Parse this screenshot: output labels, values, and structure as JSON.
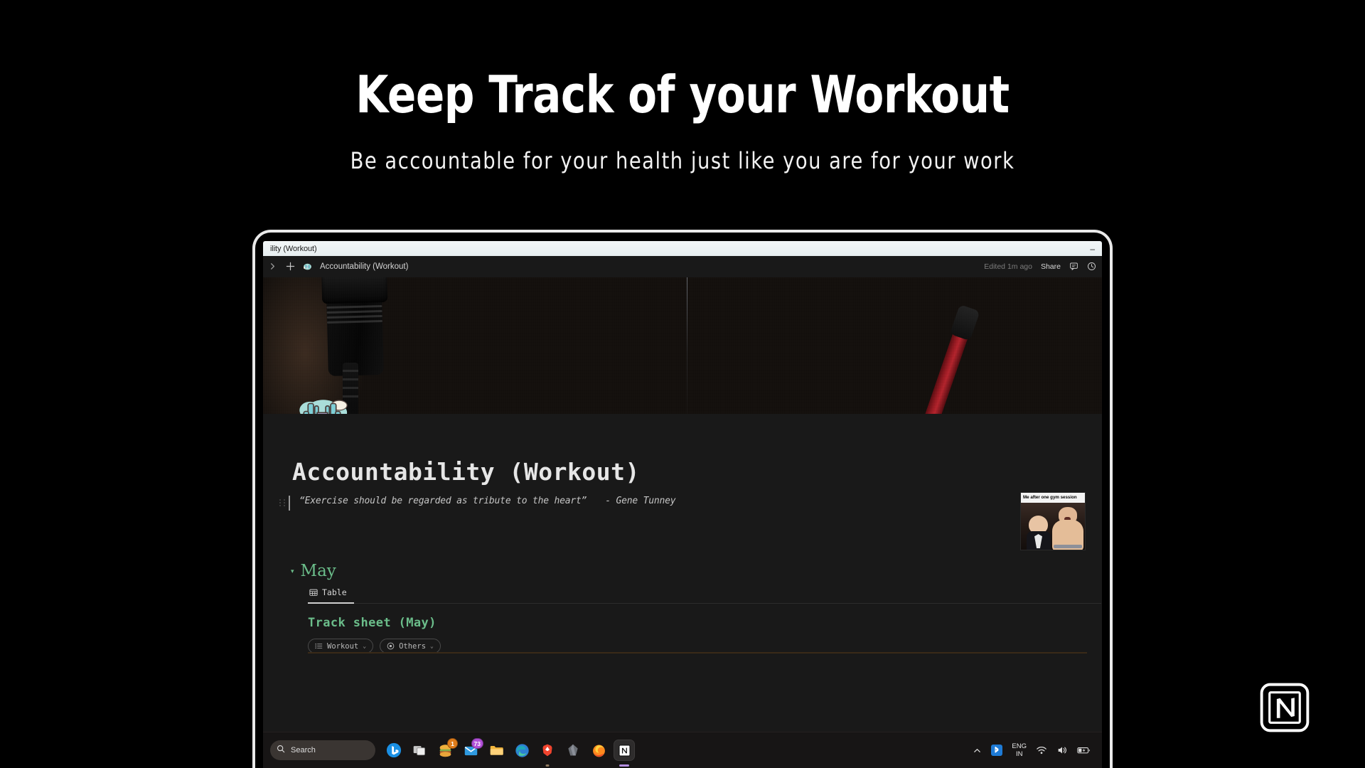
{
  "promo": {
    "title": "Keep Track of your Workout",
    "subtitle": "Be accountable for your health just like you are for your work"
  },
  "brand": {
    "name": "notion-logo",
    "letter": "N"
  },
  "window": {
    "titlebar_text": "ility (Workout)",
    "minimize_label": "–"
  },
  "notion_topbar": {
    "sidebar_toggle_icon": "chevron-right-icon",
    "new_page_icon": "plus-icon",
    "page_emoji": "weight-lifting-emoji",
    "breadcrumb": "Accountability (Workout)",
    "edited_status": "Edited 1m ago",
    "share_label": "Share",
    "comment_icon": "comment-icon",
    "history_icon": "clock-icon"
  },
  "page": {
    "cover_alt": "dark gym cover photo with shaker bottle and red barbell",
    "icon": "dumbbell-cloud-icon",
    "title": "Accountability (Workout)",
    "quote": "“Exercise should be regarded as tribute to the heart”",
    "quote_author": "- Gene Tunney",
    "meme": {
      "caption": "Me after one gym session",
      "alt": "boss baby next to muscular baby"
    }
  },
  "section": {
    "toggle_caret": "▾",
    "month_label": "May",
    "view_tabs": [
      {
        "label": "Table",
        "icon": "table-icon",
        "active": true
      }
    ],
    "database_title": "Track sheet (May)",
    "property_pills": [
      {
        "label": "Workout",
        "icon": "list-icon",
        "chevron": "⌄"
      },
      {
        "label": "Others",
        "icon": "target-icon",
        "chevron": "⌄"
      }
    ]
  },
  "taskbar": {
    "search_placeholder": "Search",
    "search_icon": "search-icon",
    "apps": [
      {
        "name": "bing-copilot-icon",
        "badge": null
      },
      {
        "name": "task-view-icon",
        "badge": null
      },
      {
        "name": "burger-app-icon",
        "badge": "1"
      },
      {
        "name": "mail-icon",
        "badge": "73"
      },
      {
        "name": "file-explorer-icon",
        "badge": null
      },
      {
        "name": "microsoft-edge-icon",
        "badge": null
      },
      {
        "name": "brave-browser-icon",
        "badge": null
      },
      {
        "name": "obsidian-icon",
        "badge": null
      },
      {
        "name": "firefox-icon",
        "badge": null
      },
      {
        "name": "notion-app-icon",
        "badge": null
      }
    ],
    "tray": {
      "overflow_icon": "chevron-up-icon",
      "bluetooth_icon": "bluetooth-icon",
      "language_line1": "ENG",
      "language_line2": "IN",
      "wifi_icon": "wifi-icon",
      "volume_icon": "speaker-icon",
      "battery_icon": "battery-charging-icon"
    }
  },
  "colors": {
    "background": "#000000",
    "notion_bg": "#191919",
    "accent_green": "#6bbd8a",
    "text_primary": "#e6e6e6",
    "text_muted": "#7c7c7c",
    "badge_purple": "#b14fd8",
    "badge_orange": "#e07c1a"
  }
}
